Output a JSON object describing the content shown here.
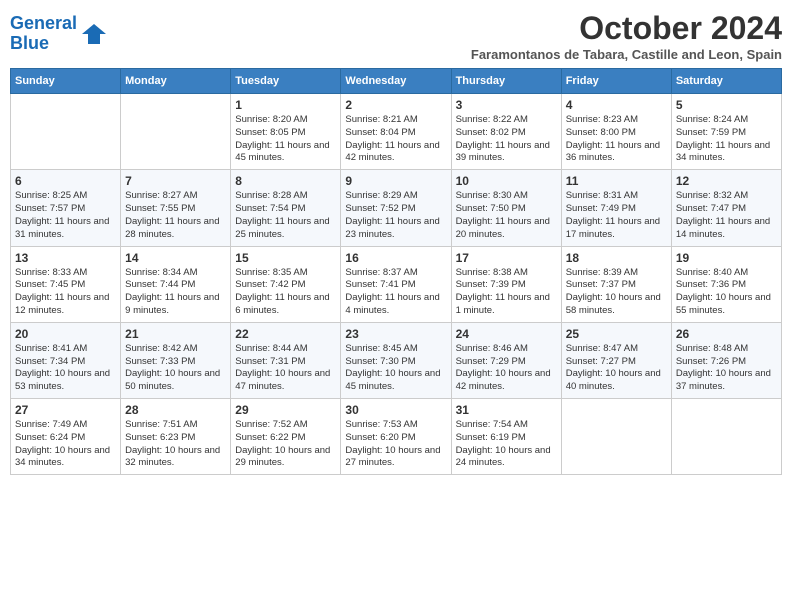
{
  "logo": {
    "line1": "General",
    "line2": "Blue"
  },
  "title": "October 2024",
  "subtitle": "Faramontanos de Tabara, Castille and Leon, Spain",
  "days_of_week": [
    "Sunday",
    "Monday",
    "Tuesday",
    "Wednesday",
    "Thursday",
    "Friday",
    "Saturday"
  ],
  "weeks": [
    [
      {
        "day": "",
        "info": ""
      },
      {
        "day": "",
        "info": ""
      },
      {
        "day": "1",
        "info": "Sunrise: 8:20 AM\nSunset: 8:05 PM\nDaylight: 11 hours and 45 minutes."
      },
      {
        "day": "2",
        "info": "Sunrise: 8:21 AM\nSunset: 8:04 PM\nDaylight: 11 hours and 42 minutes."
      },
      {
        "day": "3",
        "info": "Sunrise: 8:22 AM\nSunset: 8:02 PM\nDaylight: 11 hours and 39 minutes."
      },
      {
        "day": "4",
        "info": "Sunrise: 8:23 AM\nSunset: 8:00 PM\nDaylight: 11 hours and 36 minutes."
      },
      {
        "day": "5",
        "info": "Sunrise: 8:24 AM\nSunset: 7:59 PM\nDaylight: 11 hours and 34 minutes."
      }
    ],
    [
      {
        "day": "6",
        "info": "Sunrise: 8:25 AM\nSunset: 7:57 PM\nDaylight: 11 hours and 31 minutes."
      },
      {
        "day": "7",
        "info": "Sunrise: 8:27 AM\nSunset: 7:55 PM\nDaylight: 11 hours and 28 minutes."
      },
      {
        "day": "8",
        "info": "Sunrise: 8:28 AM\nSunset: 7:54 PM\nDaylight: 11 hours and 25 minutes."
      },
      {
        "day": "9",
        "info": "Sunrise: 8:29 AM\nSunset: 7:52 PM\nDaylight: 11 hours and 23 minutes."
      },
      {
        "day": "10",
        "info": "Sunrise: 8:30 AM\nSunset: 7:50 PM\nDaylight: 11 hours and 20 minutes."
      },
      {
        "day": "11",
        "info": "Sunrise: 8:31 AM\nSunset: 7:49 PM\nDaylight: 11 hours and 17 minutes."
      },
      {
        "day": "12",
        "info": "Sunrise: 8:32 AM\nSunset: 7:47 PM\nDaylight: 11 hours and 14 minutes."
      }
    ],
    [
      {
        "day": "13",
        "info": "Sunrise: 8:33 AM\nSunset: 7:45 PM\nDaylight: 11 hours and 12 minutes."
      },
      {
        "day": "14",
        "info": "Sunrise: 8:34 AM\nSunset: 7:44 PM\nDaylight: 11 hours and 9 minutes."
      },
      {
        "day": "15",
        "info": "Sunrise: 8:35 AM\nSunset: 7:42 PM\nDaylight: 11 hours and 6 minutes."
      },
      {
        "day": "16",
        "info": "Sunrise: 8:37 AM\nSunset: 7:41 PM\nDaylight: 11 hours and 4 minutes."
      },
      {
        "day": "17",
        "info": "Sunrise: 8:38 AM\nSunset: 7:39 PM\nDaylight: 11 hours and 1 minute."
      },
      {
        "day": "18",
        "info": "Sunrise: 8:39 AM\nSunset: 7:37 PM\nDaylight: 10 hours and 58 minutes."
      },
      {
        "day": "19",
        "info": "Sunrise: 8:40 AM\nSunset: 7:36 PM\nDaylight: 10 hours and 55 minutes."
      }
    ],
    [
      {
        "day": "20",
        "info": "Sunrise: 8:41 AM\nSunset: 7:34 PM\nDaylight: 10 hours and 53 minutes."
      },
      {
        "day": "21",
        "info": "Sunrise: 8:42 AM\nSunset: 7:33 PM\nDaylight: 10 hours and 50 minutes."
      },
      {
        "day": "22",
        "info": "Sunrise: 8:44 AM\nSunset: 7:31 PM\nDaylight: 10 hours and 47 minutes."
      },
      {
        "day": "23",
        "info": "Sunrise: 8:45 AM\nSunset: 7:30 PM\nDaylight: 10 hours and 45 minutes."
      },
      {
        "day": "24",
        "info": "Sunrise: 8:46 AM\nSunset: 7:29 PM\nDaylight: 10 hours and 42 minutes."
      },
      {
        "day": "25",
        "info": "Sunrise: 8:47 AM\nSunset: 7:27 PM\nDaylight: 10 hours and 40 minutes."
      },
      {
        "day": "26",
        "info": "Sunrise: 8:48 AM\nSunset: 7:26 PM\nDaylight: 10 hours and 37 minutes."
      }
    ],
    [
      {
        "day": "27",
        "info": "Sunrise: 7:49 AM\nSunset: 6:24 PM\nDaylight: 10 hours and 34 minutes."
      },
      {
        "day": "28",
        "info": "Sunrise: 7:51 AM\nSunset: 6:23 PM\nDaylight: 10 hours and 32 minutes."
      },
      {
        "day": "29",
        "info": "Sunrise: 7:52 AM\nSunset: 6:22 PM\nDaylight: 10 hours and 29 minutes."
      },
      {
        "day": "30",
        "info": "Sunrise: 7:53 AM\nSunset: 6:20 PM\nDaylight: 10 hours and 27 minutes."
      },
      {
        "day": "31",
        "info": "Sunrise: 7:54 AM\nSunset: 6:19 PM\nDaylight: 10 hours and 24 minutes."
      },
      {
        "day": "",
        "info": ""
      },
      {
        "day": "",
        "info": ""
      }
    ]
  ]
}
